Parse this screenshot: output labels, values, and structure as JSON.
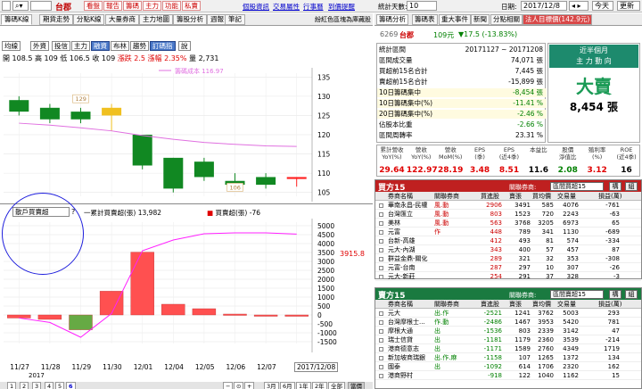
{
  "toolbar": {
    "symbol_name": "台郡",
    "red_buttons": [
      "看盤",
      "報告",
      "籌碼",
      "主力",
      "功能",
      "私賣"
    ],
    "links": [
      "個股資訊",
      "交易屬性",
      "行事曆",
      "到價提醒"
    ],
    "stat_days_label": "統計天數:",
    "stat_days_value": "10",
    "date_label": "日期:",
    "date_value": "2017/12/8",
    "today_label": "今天",
    "refresh_label": "更新"
  },
  "left_tabs": {
    "items": [
      "籌碼K線",
      "期貨走勢",
      "分點K線",
      "大量券商",
      "主力地圖",
      "籌股分析",
      "週報",
      "筆記"
    ],
    "hint": "紛紅色區塊為庫藏股"
  },
  "indicator_buttons": [
    "均線",
    "外資",
    "投信",
    "主力",
    "融資",
    "布林",
    "趨勢",
    "訂碼指",
    "說"
  ],
  "quote_line": {
    "open": "開 108.5",
    "high": "高 109",
    "low": "低 106.5",
    "close": "收 109",
    "change": "漲跌 2.5",
    "pct": "漲幅 2.35%",
    "vol": "量 2,731"
  },
  "chart_data": [
    {
      "type": "bar",
      "subtype": "candlestick",
      "title": "",
      "categories": [
        "11/27",
        "11/28",
        "11/29",
        "11/30",
        "12/01",
        "12/04",
        "12/05",
        "12/06",
        "12/07",
        "12/08"
      ],
      "open": [
        129,
        127,
        126,
        127,
        120,
        114,
        113,
        108,
        109,
        108.5
      ],
      "high": [
        130,
        128,
        127,
        128,
        120,
        114,
        114,
        110,
        110,
        109
      ],
      "low": [
        125,
        123,
        123,
        121,
        111,
        105,
        108,
        106,
        106,
        106.5
      ],
      "close": [
        126,
        124,
        124,
        125,
        112,
        106,
        109,
        107,
        107,
        109
      ],
      "legend_line_label": "籌碼成本 116.97",
      "annotations": [
        {
          "x": "11/29",
          "y": 129,
          "text": "129"
        },
        {
          "x": "12/06",
          "y": 106,
          "text": "106"
        }
      ],
      "y_ticks": [
        135,
        130,
        125,
        120,
        115,
        110,
        105
      ],
      "ylim": [
        104,
        136
      ],
      "grid": true
    },
    {
      "type": "bar",
      "title": "",
      "categories": [
        "11/27",
        "11/28",
        "11/29",
        "11/30",
        "12/01",
        "12/04",
        "12/05",
        "12/06",
        "12/07",
        "12/08"
      ],
      "series": [
        {
          "name": "一累計買賣超(張)",
          "type": "line",
          "values": [
            -172,
            -420,
            -1250,
            80,
            3600,
            4200,
            4550,
            4600,
            4600,
            4530
          ]
        },
        {
          "name": "買賣超(張)",
          "type": "bar",
          "values": [
            -172,
            -248,
            -830,
            1330,
            3520,
            600,
            350,
            50,
            0,
            -76
          ]
        }
      ],
      "cumulative_value_label": "13,982",
      "daily_value_label": "-76",
      "right_value": "3915.8",
      "y_ticks": [
        5000,
        4500,
        4000,
        3500,
        3000,
        2500,
        2000,
        1500,
        1000,
        500,
        0,
        -500,
        -1000,
        -1500
      ],
      "ylim": [
        -1600,
        5200
      ],
      "x_labels": [
        "11/27",
        "11/28",
        "11/29",
        "11/30",
        "12/01",
        "12/04",
        "12/05",
        "12/06",
        "12/07"
      ],
      "year_label": "2017",
      "date_box": "2017/12/08",
      "grid": true
    }
  ],
  "indicator_select": "散戶買賣超",
  "bottom_bar": [
    "1",
    "2",
    "3",
    "4",
    "5",
    "6",
    "3月",
    "6月",
    "1年",
    "2年",
    "全部",
    "當價"
  ],
  "right_tabs": [
    "籌碼分析",
    "籌碼表",
    "重大事件",
    "新聞",
    "分點相關",
    "法人目標價(142.9元)"
  ],
  "right_quote": {
    "code": "6269",
    "name": "台郡",
    "price": "109元",
    "change": "▼17.5 (-13.83%)"
  },
  "stats": {
    "rows": [
      {
        "label": "統計區間",
        "value": "20171127 ~ 20171208",
        "color": "#000000"
      },
      {
        "label": "區間成交量",
        "value": "74,071 張",
        "color": "#000000"
      },
      {
        "label": "買超前15名合計",
        "value": "7,445 張",
        "color": "#000000"
      },
      {
        "label": "賣超前15名合計",
        "value": "-15,899 張",
        "color": "#000000"
      },
      {
        "label": "10日籌碼集中",
        "value": "-8,454 張",
        "color": "#008000"
      },
      {
        "label": "10日籌碼集中(%)",
        "value": "-11.41 %",
        "color": "#008000"
      },
      {
        "label": "20日籌碼集中(%)",
        "value": "-2.46 %",
        "color": "#008000"
      },
      {
        "label": "佔股本比重",
        "value": "-2.66 %",
        "color": "#008000"
      },
      {
        "label": "區間周轉率",
        "value": "23.31 %",
        "color": "#000000"
      }
    ],
    "big_box": {
      "title_1": "近半個月",
      "title_2": "主 力 動 向",
      "verdict": "大賣",
      "amount": "8,454 張"
    }
  },
  "fin_table": {
    "headers": [
      "累計營收\nYoY(%)",
      "營收\nYoY(%)",
      "營收\nMoM(%)",
      "EPS\n(季)",
      "EPS\n(近4季)",
      "本益比",
      "股價\n淨值比",
      "殖利率\n(%)",
      "ROE\n(近4季)"
    ],
    "values": [
      "29.64",
      "122.97",
      "28.19",
      "3.48",
      "8.51",
      "11.6",
      "2.08",
      "3.12",
      "16"
    ],
    "colors": [
      "#e00000",
      "#e00000",
      "#e00000",
      "#e00000",
      "#e00000",
      "#000000",
      "#008000",
      "#e00000",
      "#000000"
    ]
  },
  "buy_top": {
    "title": "買方15",
    "filter_label": "關聯券商:",
    "filter_value": "區間買超15",
    "button_1": "構",
    "button_2": "組",
    "columns": [
      "券商名稱",
      "關聯券商",
      "買進股",
      "賣張",
      "買均價",
      "交易量",
      "損益(萬)"
    ],
    "rows": [
      [
        "華南永昌-民權",
        "風.動",
        "2906",
        "3491",
        "585",
        "4076",
        "-761"
      ],
      [
        "台灣匯立",
        "風.動",
        "803",
        "1523",
        "720",
        "2243",
        "-63"
      ],
      [
        "美林",
        "風.動",
        "563",
        "3768",
        "3205",
        "6973",
        "65"
      ],
      [
        "元富",
        "作",
        "448",
        "789",
        "341",
        "1130",
        "-689"
      ],
      [
        "台新-高雄",
        "",
        "412",
        "493",
        "81",
        "574",
        "-334"
      ],
      [
        "元大-內湖",
        "",
        "343",
        "400",
        "57",
        "457",
        "87"
      ],
      [
        "群益金鼎-關化",
        "",
        "289",
        "321",
        "32",
        "353",
        "-308"
      ],
      [
        "元富-台南",
        "",
        "287",
        "297",
        "10",
        "307",
        "-26"
      ],
      [
        "元大-新莊",
        "",
        "254",
        "291",
        "37",
        "328",
        "-3"
      ]
    ]
  },
  "sell_top": {
    "title": "賣方15",
    "filter_label": "關聯券商:",
    "filter_value": "區間賣超15",
    "button_1": "構",
    "button_2": "組",
    "columns": [
      "券商名稱",
      "關聯券商",
      "賣進股",
      "賣張",
      "賣均價",
      "交易量",
      "損益(萬)"
    ],
    "rows": [
      [
        "元大",
        "出.作",
        "-2521",
        "1241",
        "3762",
        "5003",
        "293"
      ],
      [
        "台灣摩根士...",
        "作.動",
        "-2486",
        "1467",
        "3953",
        "5420",
        "781"
      ],
      [
        "摩根大通",
        "出",
        "-1536",
        "803",
        "2339",
        "3142",
        "47"
      ],
      [
        "瑞士信貸",
        "出",
        "-1181",
        "1179",
        "2360",
        "3539",
        "-214"
      ],
      [
        "港商德意志",
        "出",
        "-1171",
        "1589",
        "2760",
        "4349",
        "1719"
      ],
      [
        "新加坡商瑞銀",
        "出.作.麻",
        "-1158",
        "107",
        "1265",
        "1372",
        "134"
      ],
      [
        "國泰",
        "出",
        "-1092",
        "614",
        "1706",
        "2320",
        "162"
      ],
      [
        "港商野村",
        "",
        "-918",
        "122",
        "1040",
        "1162",
        "15"
      ]
    ]
  }
}
